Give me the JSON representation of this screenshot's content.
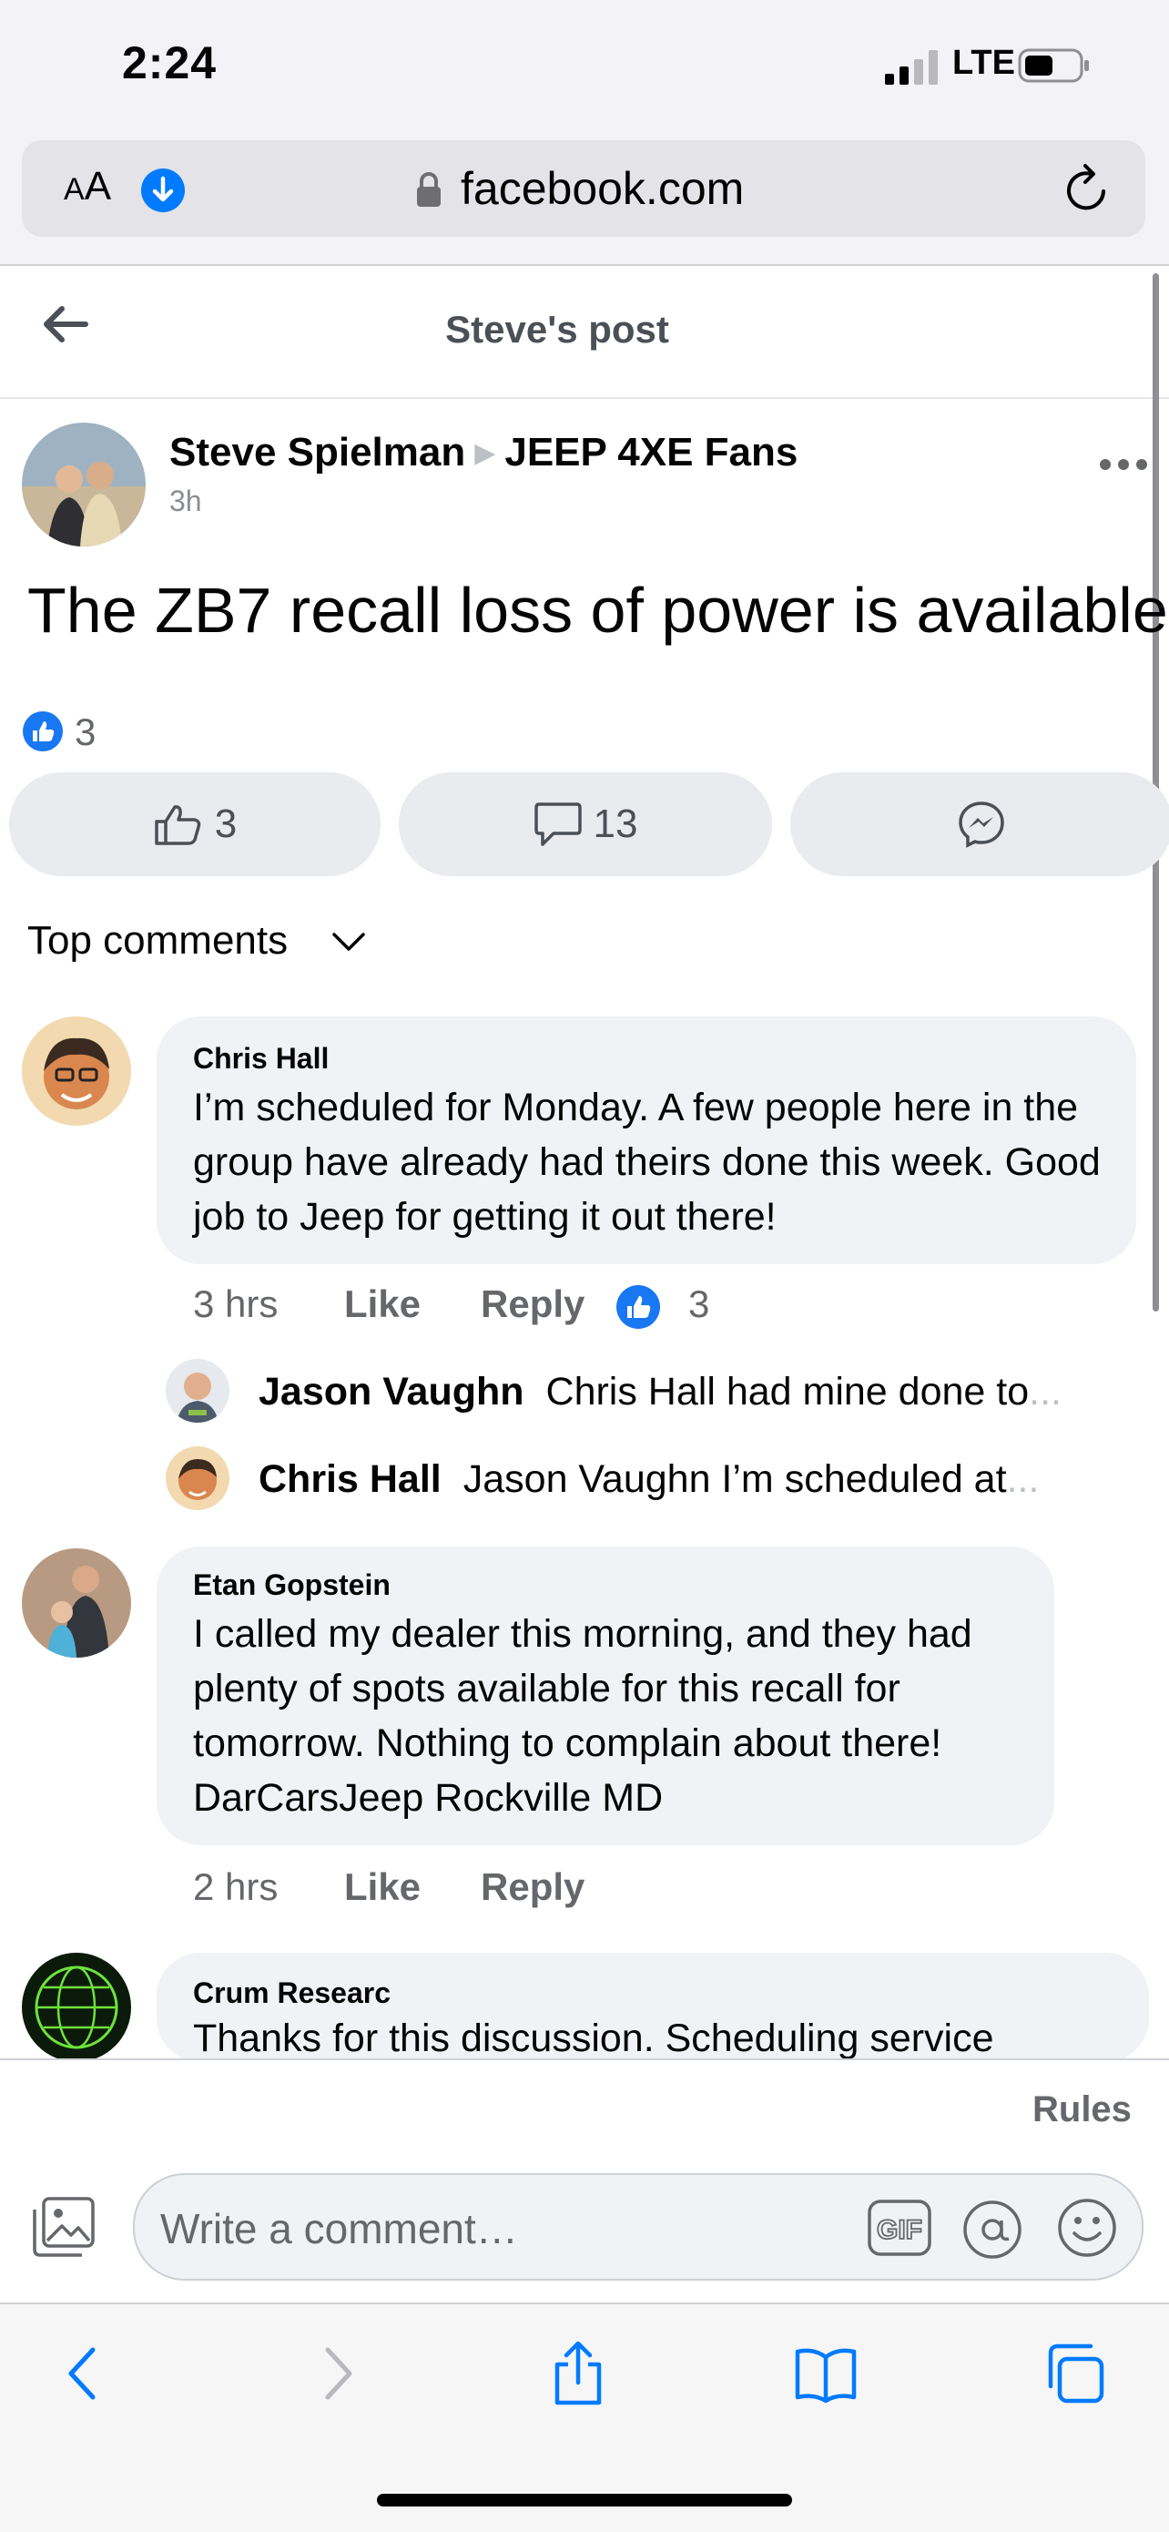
{
  "status_bar": {
    "time": "2:24",
    "network": "LTE"
  },
  "browser": {
    "text_size_label_small": "A",
    "text_size_label_large": "A",
    "url": "facebook.com"
  },
  "header": {
    "title": "Steve's post"
  },
  "post": {
    "author": "Steve Spielman",
    "group": "JEEP 4XE Fans",
    "time": "3h",
    "text": "The ZB7 recall loss of power is available",
    "reaction_count": "3",
    "actions": {
      "like_count": "3",
      "comment_count": "13"
    }
  },
  "comments_filter": "Top comments",
  "comments": [
    {
      "name": "Chris Hall",
      "text": "I’m scheduled for Monday. A few people here in the group have already had theirs done this week. Good job to Jeep for getting it out there!",
      "time": "3 hrs",
      "like": "Like",
      "reply": "Reply",
      "reaction_count": "3",
      "replies": [
        {
          "name": "Jason Vaughn",
          "text": "Chris Hall had mine done to",
          "ellipsis": "..."
        },
        {
          "name": "Chris Hall",
          "text": "Jason Vaughn I’m scheduled at",
          "ellipsis": "..."
        }
      ]
    },
    {
      "name": "Etan Gopstein",
      "text": "I called my dealer this morning, and they had plenty of spots available for this recall for tomorrow.  Nothing to complain about there! DarCarsJeep Rockville MD",
      "time": "2 hrs",
      "like": "Like",
      "reply": "Reply"
    },
    {
      "name": "Crum Researc",
      "text": "Thanks for this discussion.  Scheduling service"
    }
  ],
  "composer": {
    "rules": "Rules",
    "placeholder": "Write a comment…"
  },
  "colors": {
    "fb_blue": "#1877f2",
    "ios_blue": "#007aff",
    "bubble_gray": "#f0f2f5"
  }
}
